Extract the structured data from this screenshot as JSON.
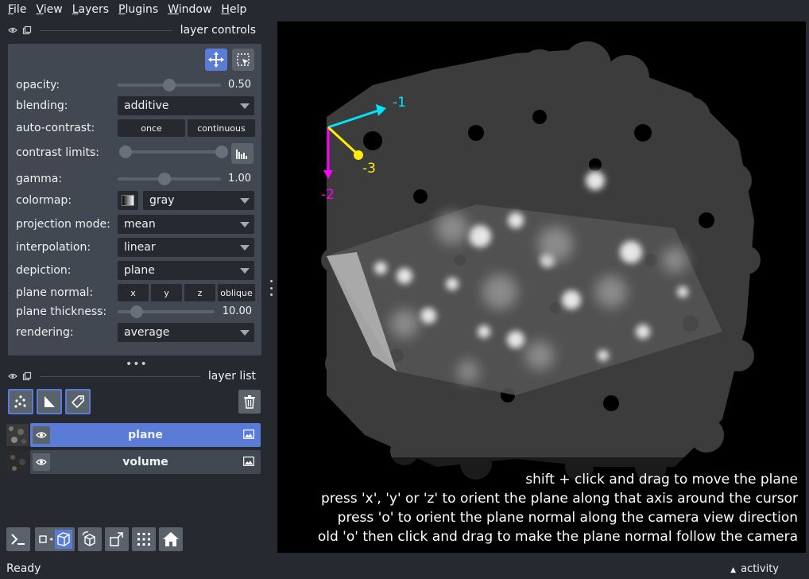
{
  "menu": [
    {
      "key": "F",
      "rest": "ile"
    },
    {
      "key": "V",
      "rest": "iew"
    },
    {
      "key": "L",
      "rest": "ayers"
    },
    {
      "key": "P",
      "rest": "lugins"
    },
    {
      "key": "W",
      "rest": "indow"
    },
    {
      "key": "H",
      "rest": "elp"
    }
  ],
  "layer_controls": {
    "title": "layer controls",
    "opacity_label": "opacity:",
    "opacity_value": "0.50",
    "opacity_fraction": 0.5,
    "blending_label": "blending:",
    "blending_value": "additive",
    "auto_contrast_label": "auto-contrast:",
    "once_label": "once",
    "continuous_label": "continuous",
    "contrast_limits_label": "contrast limits:",
    "gamma_label": "gamma:",
    "gamma_value": "1.00",
    "gamma_fraction": 0.45,
    "colormap_label": "colormap:",
    "colormap_value": "gray",
    "projection_label": "projection mode:",
    "projection_value": "mean",
    "interpolation_label": "interpolation:",
    "interpolation_value": "linear",
    "depiction_label": "depiction:",
    "depiction_value": "plane",
    "plane_normal_label": "plane normal:",
    "normal_x": "x",
    "normal_y": "y",
    "normal_z": "z",
    "normal_oblique": "oblique",
    "plane_thickness_label": "plane thickness:",
    "plane_thickness_value": "10.00",
    "plane_thickness_fraction": 0.2,
    "rendering_label": "rendering:",
    "rendering_value": "average"
  },
  "layer_list": {
    "title": "layer list",
    "layers": [
      {
        "name": "plane",
        "selected": true
      },
      {
        "name": "volume",
        "selected": false
      }
    ]
  },
  "canvas": {
    "axes": {
      "x_label": "-1",
      "y_label": "-2",
      "z_label": "-3",
      "x_color": "#00e5ff",
      "y_color": "#ff00ff",
      "z_color": "#ffee00"
    },
    "help_lines": [
      "shift + click and drag to move the plane",
      "press 'x', 'y' or 'z' to orient the plane along that axis around the cursor",
      "press 'o' to orient the plane normal along the camera view direction",
      "old 'o' then click and drag to make the plane normal follow the camera"
    ]
  },
  "status": {
    "text": "Ready",
    "activity": "activity"
  },
  "colors": {
    "accent": "#5a7bd6",
    "panel": "#414851",
    "background": "#262930"
  }
}
